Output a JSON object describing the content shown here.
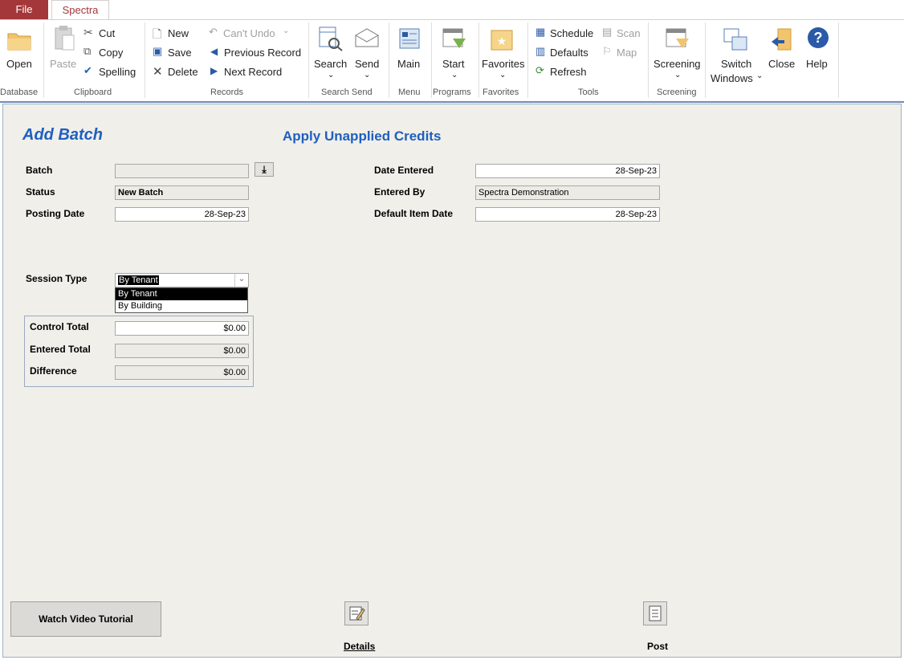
{
  "tabs": {
    "file": "File",
    "spectra": "Spectra"
  },
  "ribbon": {
    "database": {
      "open": "Open",
      "group": "Database"
    },
    "clipboard": {
      "paste": "Paste",
      "cut": "Cut",
      "copy": "Copy",
      "spelling": "Spelling",
      "group": "Clipboard"
    },
    "records": {
      "new": "New",
      "save": "Save",
      "delete": "Delete",
      "cant_undo": "Can't Undo",
      "previous": "Previous Record",
      "next": "Next Record",
      "group": "Records"
    },
    "search_send": {
      "search": "Search",
      "send": "Send",
      "group": "Search Send"
    },
    "menu": {
      "main": "Main",
      "group": "Menu"
    },
    "programs": {
      "start": "Start",
      "group": "Programs"
    },
    "favorites": {
      "favorites": "Favorites",
      "group": "Favorites"
    },
    "tools": {
      "schedule": "Schedule",
      "scan": "Scan",
      "defaults": "Defaults",
      "map": "Map",
      "refresh": "Refresh",
      "group": "Tools"
    },
    "screening": {
      "screening": "Screening",
      "group": "Screening"
    },
    "window": {
      "switch": "Switch",
      "windows": "Windows",
      "close": "Close",
      "help": "Help"
    }
  },
  "form": {
    "title": "Add Batch",
    "subtitle": "Apply Unapplied Credits",
    "labels": {
      "batch": "Batch",
      "status": "Status",
      "posting_date": "Posting Date",
      "date_entered": "Date Entered",
      "entered_by": "Entered By",
      "default_item_date": "Default Item Date",
      "session_type": "Session Type",
      "control_total": "Control Total",
      "entered_total": "Entered Total",
      "difference": "Difference"
    },
    "values": {
      "batch": "",
      "status": "New Batch",
      "posting_date": "28-Sep-23",
      "date_entered": "28-Sep-23",
      "entered_by": "Spectra Demonstration",
      "default_item_date": "28-Sep-23",
      "session_type": "By Tenant",
      "control_total": "$0.00",
      "entered_total": "$0.00",
      "difference": "$0.00"
    },
    "session_options": [
      "By Tenant",
      "By Building"
    ],
    "buttons": {
      "watch": "Watch Video Tutorial",
      "details": "Details",
      "post": "Post"
    }
  },
  "colors": {
    "file_tab": "#a4373a",
    "title_blue": "#1f5fbf",
    "form_bg": "#f0efea"
  }
}
